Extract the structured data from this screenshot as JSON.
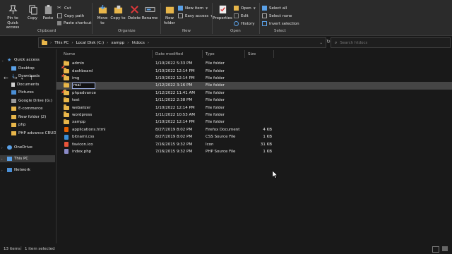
{
  "ribbon": {
    "clipboard": {
      "pin_label": "Pin to Quick access",
      "copy_label": "Copy",
      "paste_label": "Paste",
      "cut_label": "Cut",
      "copy_path_label": "Copy path",
      "paste_shortcut_label": "Paste shortcut",
      "group_label": "Clipboard"
    },
    "organize": {
      "move_to_label": "Move to",
      "copy_to_label": "Copy to",
      "delete_label": "Delete",
      "rename_label": "Rename",
      "group_label": "Organize"
    },
    "new": {
      "new_folder_label": "New folder",
      "new_item_label": "New item",
      "easy_access_label": "Easy access",
      "group_label": "New"
    },
    "open": {
      "properties_label": "Properties",
      "open_label": "Open",
      "edit_label": "Edit",
      "history_label": "History",
      "group_label": "Open"
    },
    "select": {
      "select_all_label": "Select all",
      "select_none_label": "Select none",
      "invert_label": "Invert selection",
      "group_label": "Select"
    }
  },
  "address": {
    "crumbs": [
      "This PC",
      "Local Disk (C:)",
      "xampp",
      "htdocs"
    ],
    "search_placeholder": "Search htdocs"
  },
  "sidebar": {
    "items": [
      {
        "label": "Quick access"
      },
      {
        "label": "Desktop"
      },
      {
        "label": "Downloads"
      },
      {
        "label": "Documents"
      },
      {
        "label": "Pictures"
      },
      {
        "label": "Google Drive (G:)"
      },
      {
        "label": "E-commerce"
      },
      {
        "label": "New folder (2)"
      },
      {
        "label": "php"
      },
      {
        "label": "PHP advance CRUD"
      },
      {
        "label": "OneDrive"
      },
      {
        "label": "This PC"
      },
      {
        "label": "Network"
      }
    ]
  },
  "columns": {
    "name": "Name",
    "date": "Date modified",
    "type": "Type",
    "size": "Size"
  },
  "files": [
    {
      "name": "admin",
      "date": "1/10/2022 5:33 PM",
      "type": "File folder",
      "size": ""
    },
    {
      "name": "dashboard",
      "date": "1/10/2022 12:14 PM",
      "type": "File folder",
      "size": ""
    },
    {
      "name": "img",
      "date": "1/10/2022 12:14 PM",
      "type": "File folder",
      "size": ""
    },
    {
      "name": "mai",
      "date": "1/12/2022 3:16 PM",
      "type": "File folder",
      "size": ""
    },
    {
      "name": "phpadvance",
      "date": "1/12/2022 11:41 AM",
      "type": "File folder",
      "size": ""
    },
    {
      "name": "test",
      "date": "1/11/2022 2:38 PM",
      "type": "File folder",
      "size": ""
    },
    {
      "name": "webalizer",
      "date": "1/10/2022 12:14 PM",
      "type": "File folder",
      "size": ""
    },
    {
      "name": "wordpress",
      "date": "1/11/2022 10:53 AM",
      "type": "File folder",
      "size": ""
    },
    {
      "name": "xampp",
      "date": "1/10/2022 12:14 PM",
      "type": "File folder",
      "size": ""
    },
    {
      "name": "applications.html",
      "date": "8/27/2019 8:02 PM",
      "type": "Firefox Document",
      "size": "4 KB"
    },
    {
      "name": "bitnami.css",
      "date": "8/27/2019 8:02 PM",
      "type": "CSS Source File",
      "size": "1 KB"
    },
    {
      "name": "favicon.ico",
      "date": "7/16/2015 9:32 PM",
      "type": "Icon",
      "size": "31 KB"
    },
    {
      "name": "index.php",
      "date": "7/16/2015 9:32 PM",
      "type": "PHP Source File",
      "size": "1 KB"
    }
  ],
  "status": {
    "count": "13 items",
    "selected": "1 item selected"
  },
  "colors": {
    "folder": "#e8b64a",
    "selected_row": "#454545",
    "background": "#191919"
  }
}
